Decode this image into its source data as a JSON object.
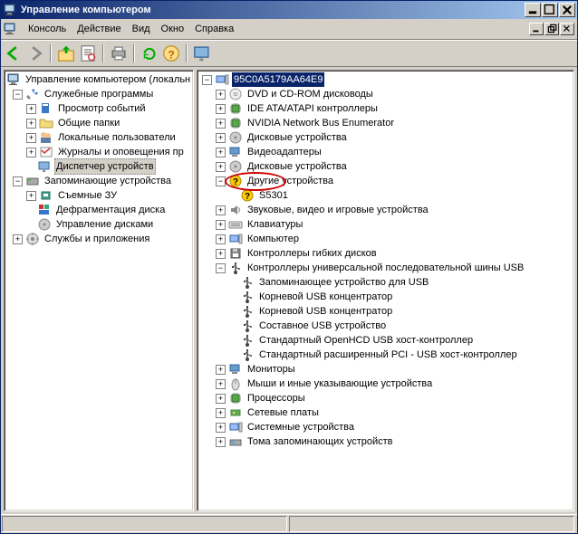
{
  "title": "Управление компьютером",
  "menu": [
    "Консоль",
    "Действие",
    "Вид",
    "Окно",
    "Справка"
  ],
  "left_tree": {
    "root": "Управление компьютером (локальн",
    "svc": "Служебные программы",
    "svc_items": [
      "Просмотр событий",
      "Общие папки",
      "Локальные пользователи",
      "Журналы и оповещения пр"
    ],
    "svc_sel": "Диспетчер устройств",
    "storage": "Запоминающие устройства",
    "storage_items": [
      "Съемные ЗУ",
      "Дефрагментация диска",
      "Управление дисками"
    ],
    "services": "Службы и приложения"
  },
  "right_tree": {
    "root": "95C0A5179AA64E9",
    "items_top": [
      "DVD и CD-ROM дисководы",
      "IDE ATA/ATAPI контроллеры",
      "NVIDIA Network Bus Enumerator",
      "Дисковые устройства",
      "Видеоадаптеры",
      "Дисковые устройства"
    ],
    "other": "Другие устройства",
    "other_child": "S5301",
    "items_mid": [
      "Звуковые, видео и игровые устройства",
      "Клавиатуры",
      "Компьютер",
      "Контроллеры гибких дисков"
    ],
    "usb": "Контроллеры универсальной последовательной шины USB",
    "usb_items": [
      "Запоминающее устройство для USB",
      "Корневой USB концентратор",
      "Корневой USB концентратор",
      "Составное USB устройство",
      "Стандартный OpenHCD USB хост-контроллер",
      "Стандартный расширенный PCI - USB хост-контроллер"
    ],
    "items_bot": [
      "Мониторы",
      "Мыши и иные указывающие устройства",
      "Процессоры",
      "Сетевые платы",
      "Системные устройства",
      "Тома запоминающих устройств"
    ]
  }
}
